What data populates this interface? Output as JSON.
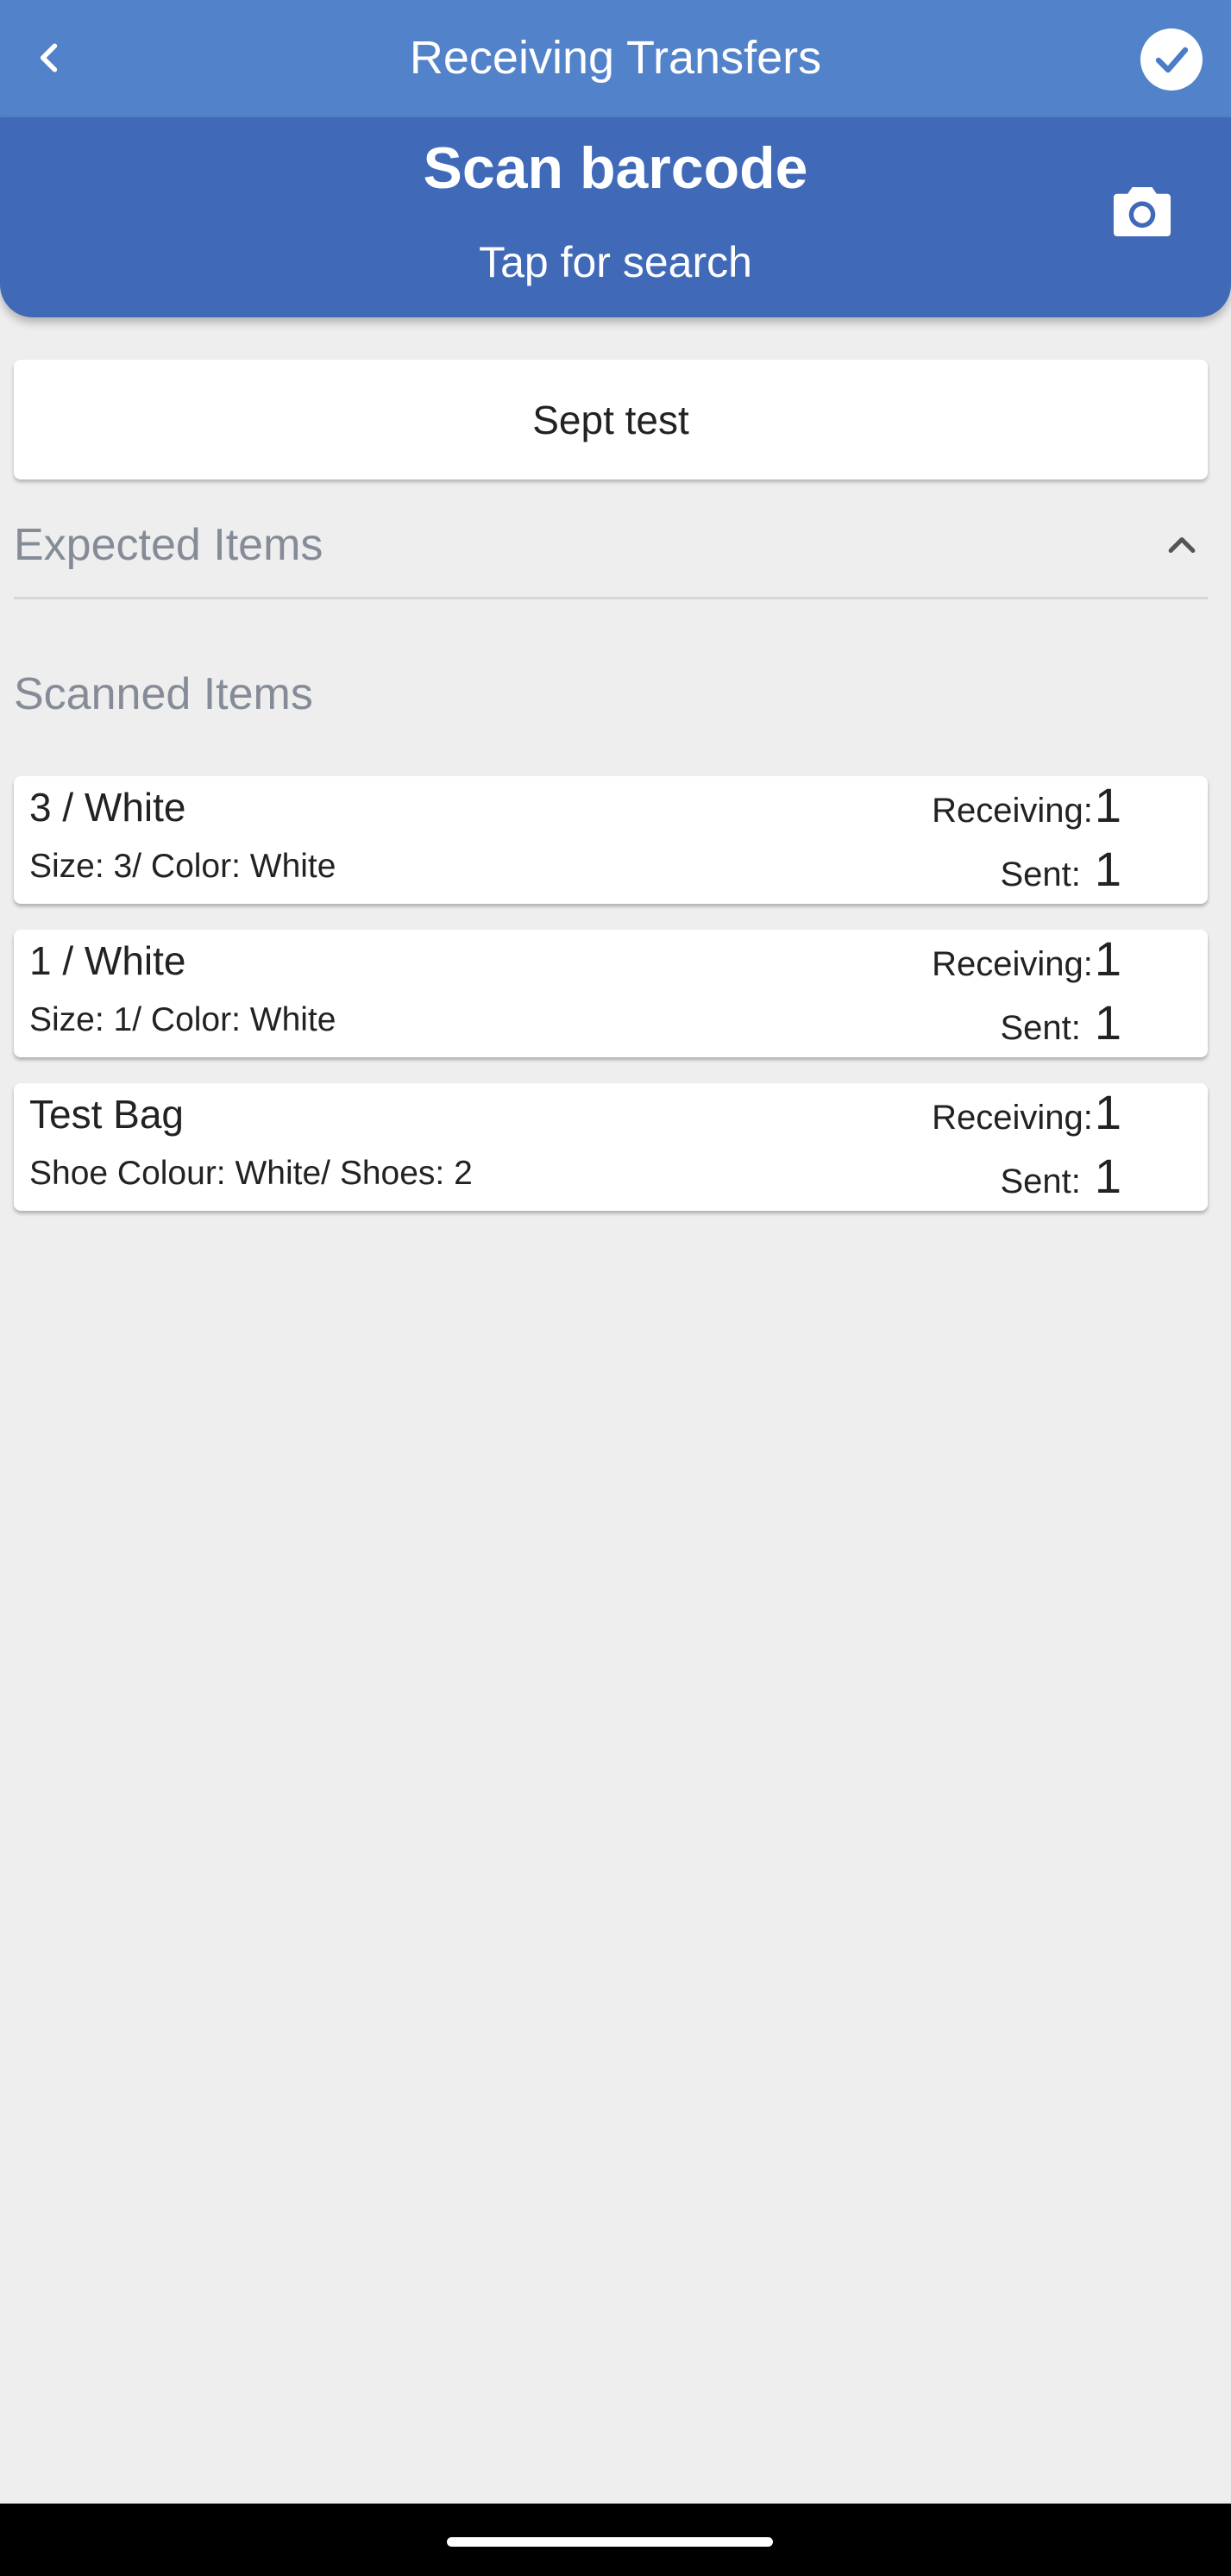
{
  "header": {
    "title": "Receiving Transfers",
    "back_icon": "chevron-left-icon",
    "confirm_icon": "check-circle-icon"
  },
  "scan": {
    "title": "Scan barcode",
    "subtitle": "Tap for search",
    "camera_icon": "camera-icon"
  },
  "transfer": {
    "name": "Sept test"
  },
  "expected_section": {
    "label": "Expected Items",
    "expanded": true,
    "toggle_icon": "chevron-up-icon"
  },
  "scanned_section": {
    "label": "Scanned Items",
    "items": [
      {
        "name": "3 / White",
        "description": "Size: 3/ Color: White",
        "receiving_label": "Receiving:",
        "receiving": "1",
        "sent_label": "Sent:",
        "sent": "1"
      },
      {
        "name": "1 / White",
        "description": "Size: 1/ Color: White",
        "receiving_label": "Receiving:",
        "receiving": "1",
        "sent_label": "Sent:",
        "sent": "1"
      },
      {
        "name": "Test Bag",
        "description": "Shoe Colour: White/ Shoes: 2",
        "receiving_label": "Receiving:",
        "receiving": "1",
        "sent_label": "Sent:",
        "sent": "1"
      }
    ]
  },
  "colors": {
    "topbar": "#5282c9",
    "scan_panel": "#4069b8",
    "background": "#eeeeee",
    "section_label": "#858c98"
  }
}
